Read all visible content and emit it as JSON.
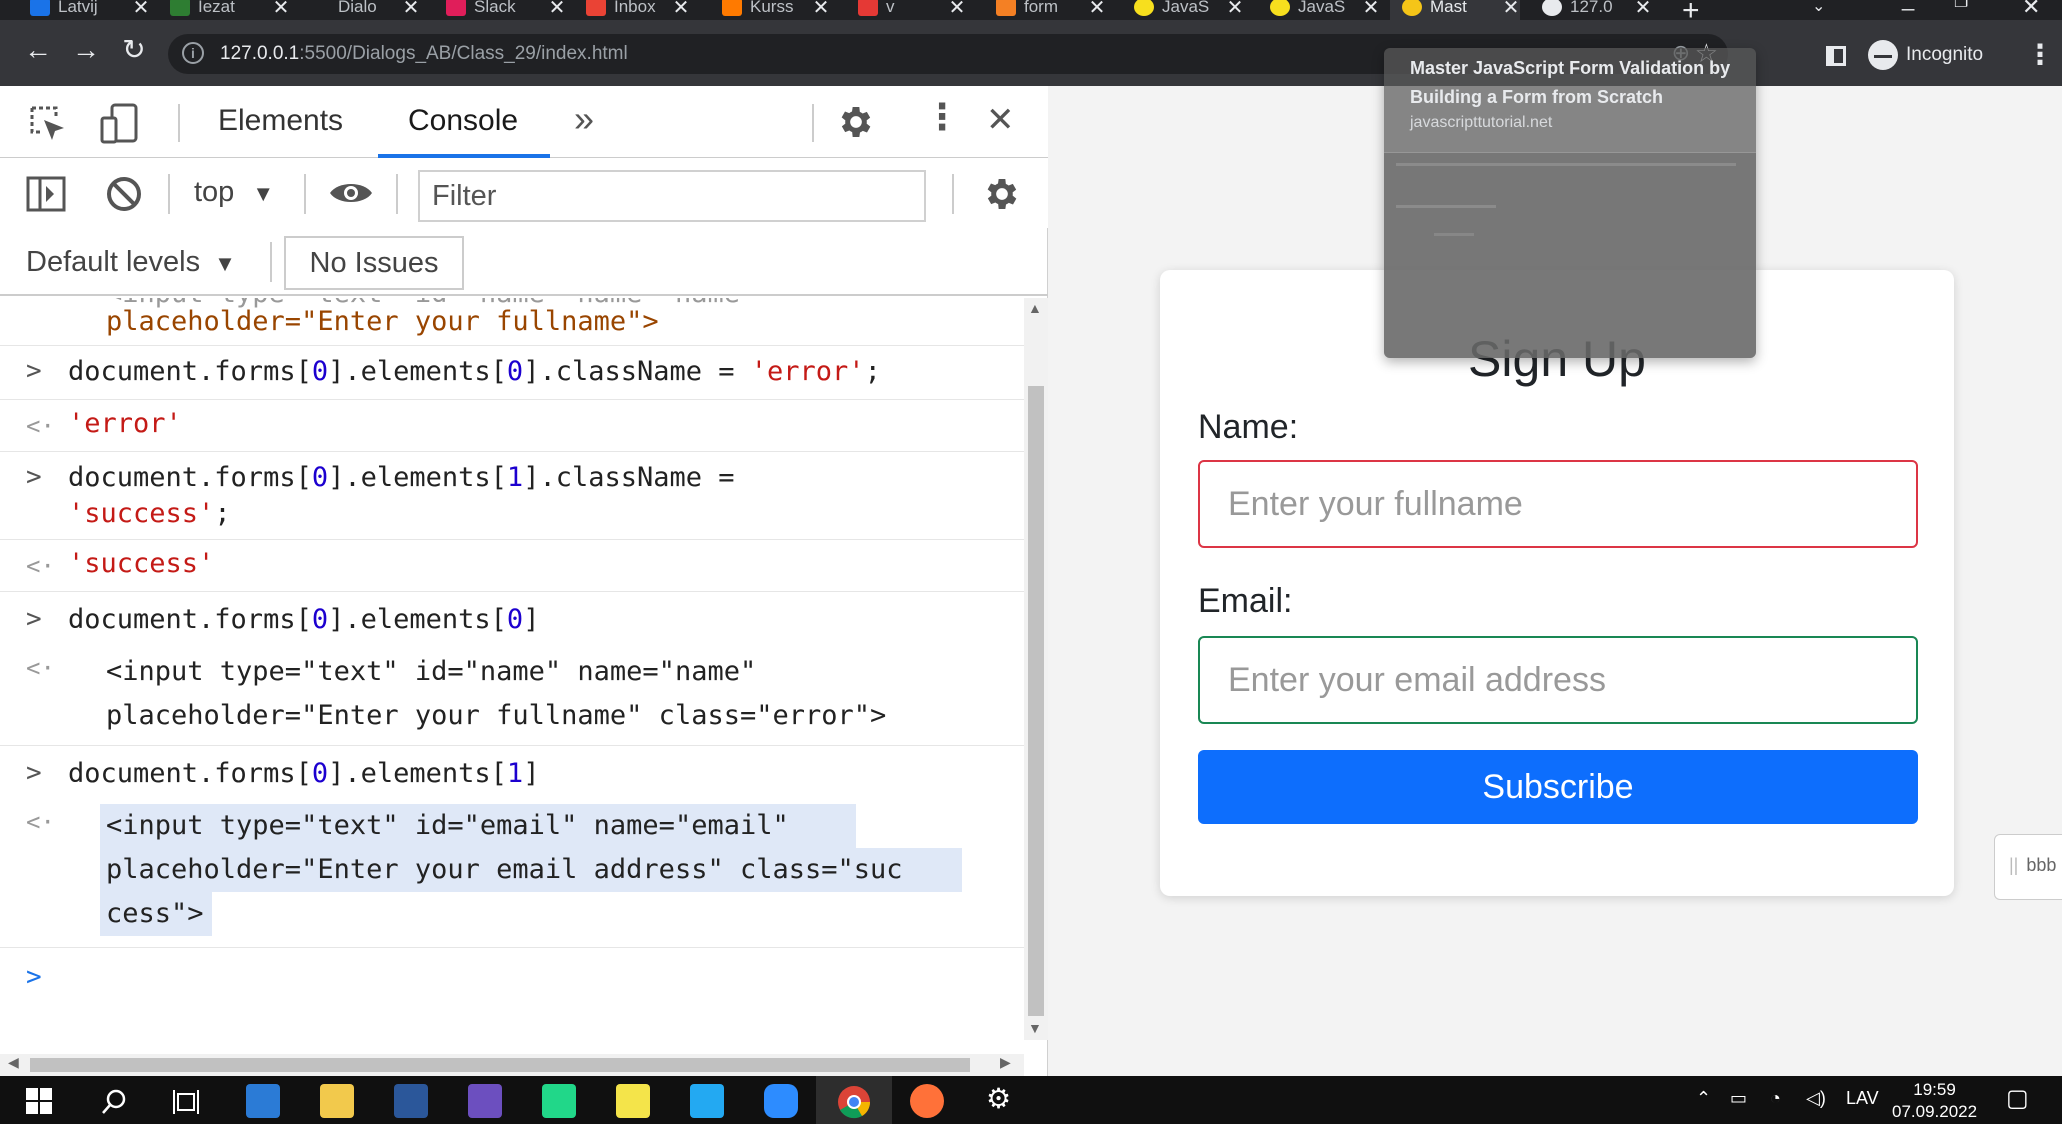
{
  "browser": {
    "tabs": [
      {
        "label": "Latvij",
        "color": "#1a73e8"
      },
      {
        "label": "Iezat",
        "color": "#2e7d32"
      },
      {
        "label": "Dialo",
        "color": "#202124"
      },
      {
        "label": "Slack",
        "color": "#e01e5a"
      },
      {
        "label": "Inbox",
        "color": "#ea4335"
      },
      {
        "label": "Kurss",
        "color": "#ff7a00"
      },
      {
        "label": "v",
        "color": "#e53935"
      },
      {
        "label": "form",
        "color": "#f48024"
      },
      {
        "label": "JavaS",
        "color": "#f7df1e"
      },
      {
        "label": "JavaS",
        "color": "#f7df1e"
      },
      {
        "label": "Mast",
        "color": "#f5c518"
      },
      {
        "label": "127.0",
        "color": "#e8eaed"
      }
    ],
    "new_tab": "+",
    "close_glyph": "✕",
    "back": "←",
    "forward": "→",
    "reload": "↻",
    "url_host": "127.0.0.1",
    "url_path": ":5500/Dialogs_AB/Class_29/index.html",
    "incognito_label": "Incognito",
    "star": "☆",
    "zoom": "⊕",
    "menu": "⋮",
    "hovercard": {
      "title": "Master JavaScript Form Validation by Building a Form from Scratch",
      "site": "javascripttutorial.net"
    }
  },
  "devtools": {
    "tabs": {
      "elements": "Elements",
      "console": "Console",
      "more": "»"
    },
    "close": "✕",
    "context": "top",
    "context_arrow": "▼",
    "filter_placeholder": "Filter",
    "levels": "Default levels",
    "levels_arrow": "▼",
    "issues": "No Issues",
    "console_lines": {
      "partial_top": "placeholder=\"Enter your fullname\">",
      "cmd1_a": "document.forms[",
      "cmd1_b": "0",
      "cmd1_c": "].elements[",
      "cmd1_d": "0",
      "cmd1_e": "].className = ",
      "cmd1_f": "'error'",
      "cmd1_g": ";",
      "out1": "'error'",
      "cmd2_a": "document.forms[",
      "cmd2_b": "0",
      "cmd2_c": "].elements[",
      "cmd2_d": "1",
      "cmd2_e": "].className =",
      "cmd2_f": "'success'",
      "cmd2_g": ";",
      "out2": "'success'",
      "cmd3_a": "document.forms[",
      "cmd3_b": "0",
      "cmd3_c": "].elements[",
      "cmd3_d": "0",
      "cmd3_e": "]",
      "cmd4_a": "document.forms[",
      "cmd4_b": "0",
      "cmd4_c": "].elements[",
      "cmd4_d": "1",
      "cmd4_e": "]",
      "out3_l1": "<input type=\"text\" id=\"name\" name=\"name\"",
      "out3_l2": "placeholder=\"Enter your fullname\" class=\"error\">",
      "out4_l1": "<input type=\"text\" id=\"email\" name=\"email\"",
      "out4_l2": "placeholder=\"Enter your email address\" class=\"suc",
      "out4_l3": "cess\">",
      "prompt": ">",
      "in_glyph": ">",
      "out_glyph": "<·"
    }
  },
  "page": {
    "heading": "Sign Up",
    "name_label": "Name:",
    "name_placeholder": "Enter your fullname",
    "email_label": "Email:",
    "email_placeholder": "Enter your email address",
    "subscribe": "Subscribe",
    "sidetab": "bbb"
  },
  "taskbar": {
    "lang": "LAV",
    "time": "19:59",
    "date": "07.09.2022"
  },
  "colors": {
    "error": "#dc3545",
    "success": "#198754",
    "primary": "#0d6efd",
    "devtools_accent": "#1a73e8"
  }
}
